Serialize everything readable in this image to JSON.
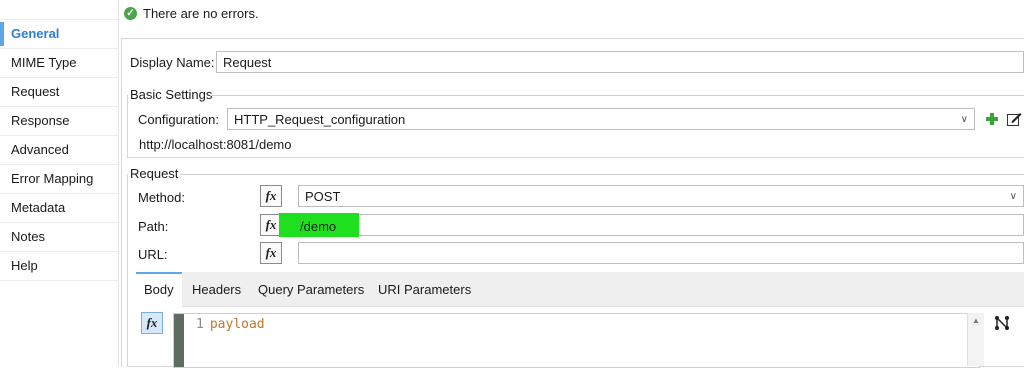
{
  "status": {
    "message": "There are no errors."
  },
  "sidebar": {
    "items": [
      {
        "label": "General"
      },
      {
        "label": "MIME Type"
      },
      {
        "label": "Request"
      },
      {
        "label": "Response"
      },
      {
        "label": "Advanced"
      },
      {
        "label": "Error Mapping"
      },
      {
        "label": "Metadata"
      },
      {
        "label": "Notes"
      },
      {
        "label": "Help"
      }
    ]
  },
  "general": {
    "display_name_label": "Display Name:",
    "display_name_value": "Request"
  },
  "basic_settings": {
    "title": "Basic Settings",
    "configuration_label": "Configuration:",
    "configuration_value": "HTTP_Request_configuration",
    "url_hint": "http://localhost:8081/demo"
  },
  "request": {
    "title": "Request",
    "method_label": "Method:",
    "method_value": "POST",
    "path_label": "Path:",
    "path_value": "/demo",
    "url_label": "URL:",
    "url_value": "",
    "fx_label": "fx"
  },
  "tabs": [
    {
      "label": "Body"
    },
    {
      "label": "Headers"
    },
    {
      "label": "Query Parameters"
    },
    {
      "label": "URI Parameters"
    }
  ],
  "editor": {
    "line_number": "1",
    "content": "payload"
  },
  "colors": {
    "accent": "#5fa6e6",
    "highlight": "#1ee01e",
    "ok": "#4aa54a"
  }
}
